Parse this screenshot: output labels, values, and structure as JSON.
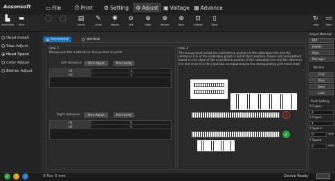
{
  "app": {
    "logo": "Aosonsoft"
  },
  "menu": [
    {
      "label": "File",
      "icon": "folder-icon"
    },
    {
      "label": "Print",
      "icon": "printer-icon"
    },
    {
      "label": "Setting",
      "icon": "gear-icon"
    },
    {
      "label": "Adjust",
      "icon": "adjust-icon",
      "active": true
    },
    {
      "label": "Voltage",
      "icon": "voltage-icon"
    },
    {
      "label": "Advance",
      "icon": "advance-icon"
    }
  ],
  "toolbar": {
    "items": [
      "SpeedTest",
      "Print",
      "Check",
      "Clean",
      "Margin",
      "Left",
      "Right",
      "Moved",
      "Back",
      "X-Reset",
      "Spot"
    ],
    "right": [
      "Load",
      "Save"
    ]
  },
  "sidebar": {
    "items": [
      {
        "label": "Head Install"
      },
      {
        "label": "Step Adjust"
      },
      {
        "label": "Head Space",
        "active": true
      },
      {
        "label": "Color Adjust"
      },
      {
        "label": "Bidirec Adjust"
      }
    ]
  },
  "tabs": {
    "horizontal": "Horizontal",
    "vertical": "Vertical"
  },
  "step1": {
    "title": "step 1",
    "instruction": "Please put the material on the printer to print",
    "left_label": "Left distance:",
    "right_label": "Right distance:",
    "print_adjust": "Print Adjust",
    "print_verify": "Print Verify",
    "left_rows": [
      {
        "name": "H1",
        "value": "-1"
      },
      {
        "name": "H2",
        "value": "-1"
      }
    ],
    "right_rows": [
      {
        "name": "H1",
        "value": "0"
      },
      {
        "name": "H2",
        "value": "0"
      }
    ]
  },
  "step2": {
    "title": "step 2",
    "text": "The wrong result is that the coincidence position of the calibration line and the reference line of the calibration graph is not at the 0 position. Please add and subtract based on the value of the coincidence position of the calibration line and the reference line and enter it in the input box corresponding to the corresponding print head mark."
  },
  "right_panel": {
    "adjust_title": "Adjust Material",
    "materials": [
      "PET",
      "Middle",
      "High",
      "Manager"
    ],
    "wizard_title": "Wizard",
    "wizard": [
      "First",
      "Prev",
      "Next",
      "Last"
    ],
    "print_setting": "Print Setting",
    "x_copys_label": "X Copys:",
    "x_copys": "3",
    "y_copys_label": "Y Copys:",
    "y_copys": "1",
    "x_space_label": "X Space:",
    "x_space": "0",
    "x_space_unit": "mm",
    "y_space_label": "Y Space:",
    "y_space": "0",
    "y_space_unit": "mm"
  },
  "status": {
    "pos": "X Pos: 0 mm",
    "device": "Device Ready",
    "colors": {
      "green": "#3b9a3b",
      "yellow": "#d9a21a",
      "blue": "#2a79c9"
    }
  }
}
